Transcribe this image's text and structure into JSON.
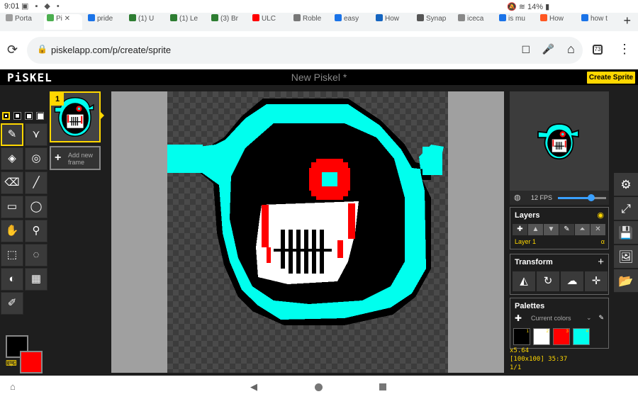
{
  "status": {
    "time": "9:01",
    "battery": "14%"
  },
  "browser": {
    "tabs": [
      {
        "label": "Porta",
        "color": "#9e9e9e"
      },
      {
        "label": "Pi",
        "color": "#4caf50",
        "active": true
      },
      {
        "label": "pride",
        "color": "#1a73e8"
      },
      {
        "label": "(1) U",
        "color": "#2e7d32"
      },
      {
        "label": "(1) Le",
        "color": "#2e7d32"
      },
      {
        "label": "(3) Br",
        "color": "#2e7d32"
      },
      {
        "label": "ULC",
        "color": "#ff0000"
      },
      {
        "label": "Roble",
        "color": "#777777"
      },
      {
        "label": "easy",
        "color": "#1a73e8"
      },
      {
        "label": "How",
        "color": "#1565c0"
      },
      {
        "label": "Synap",
        "color": "#555555"
      },
      {
        "label": "iceca",
        "color": "#888888"
      },
      {
        "label": "is mu",
        "color": "#1a73e8"
      },
      {
        "label": "How",
        "color": "#ff5722"
      },
      {
        "label": "how t",
        "color": "#1a73e8"
      }
    ],
    "url": "piskelapp.com/p/create/sprite",
    "tab_count": "73"
  },
  "app": {
    "logo": "PiSKEL",
    "title": "New Piskel *",
    "create_button": "Create Sprite",
    "frame_number": "1",
    "add_frame_line1": "Add new",
    "add_frame_line2": "frame",
    "fps_label": "12 FPS",
    "fps_value": 12,
    "layers_title": "Layers",
    "layer_name": "Layer 1",
    "layer_alpha": "α",
    "transform_title": "Transform",
    "palettes_title": "Palettes",
    "palette_name": "Current colors",
    "swatches": [
      {
        "num": "1",
        "color": "#000000"
      },
      {
        "num": "2",
        "color": "#ffffff"
      },
      {
        "num": "3",
        "color": "#ff0000"
      },
      {
        "num": "4",
        "color": "#00ffee"
      }
    ],
    "zoom": "x5.64",
    "size_coords": "[100x100] 35:37",
    "frame_count": "1/1",
    "primary_color": "#000000",
    "secondary_color": "#ff0000"
  }
}
